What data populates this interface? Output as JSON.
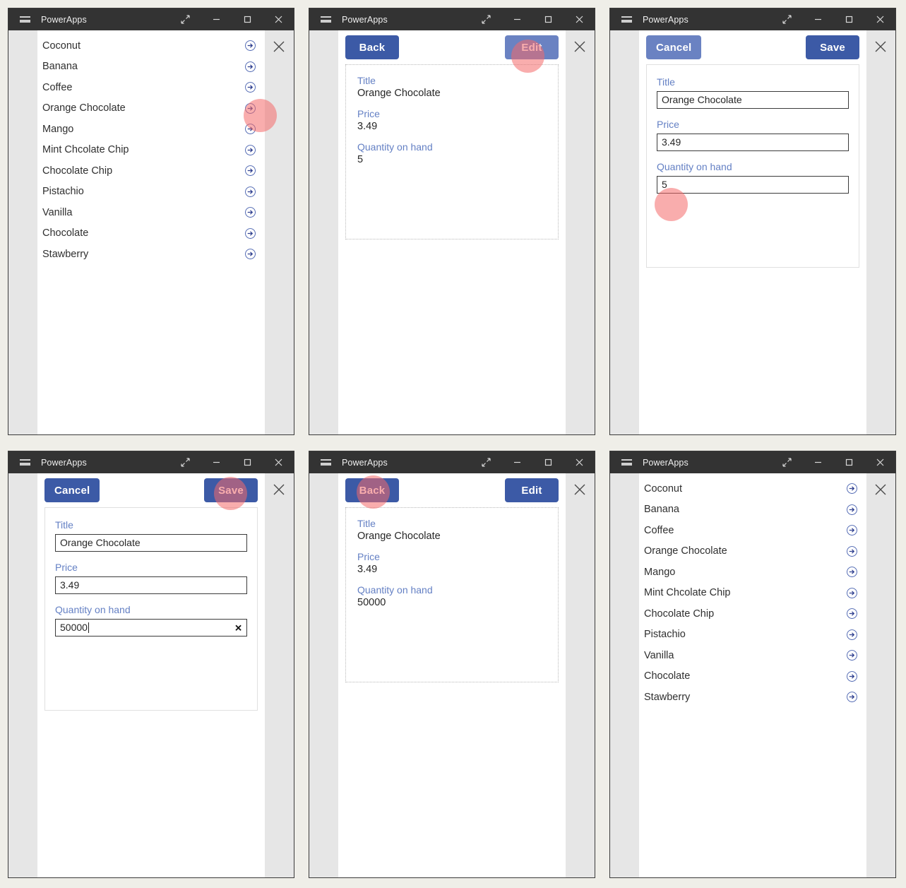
{
  "window": {
    "title": "PowerApps",
    "menu_icon": "hamburger-icon",
    "restore_icon": "expand-diagonal-icon",
    "minimize_icon": "minimize-icon",
    "maximize_icon": "maximize-icon",
    "close_icon": "close-icon",
    "app_close_icon": "close-icon"
  },
  "gallery": {
    "items": [
      "Coconut",
      "Banana",
      "Coffee",
      "Orange Chocolate",
      "Mango",
      "Mint Chcolate Chip",
      "Chocolate Chip",
      "Pistachio",
      "Vanilla",
      "Chocolate",
      "Stawberry"
    ],
    "row_icon": "arrow-right-circle-icon"
  },
  "detail": {
    "back_label": "Back",
    "edit_label": "Edit",
    "fields": [
      {
        "label": "Title",
        "value": "Orange Chocolate"
      },
      {
        "label": "Price",
        "value": "3.49"
      },
      {
        "label": "Quantity on hand",
        "value": "5"
      }
    ],
    "fields_after": [
      {
        "label": "Title",
        "value": "Orange Chocolate"
      },
      {
        "label": "Price",
        "value": "3.49"
      },
      {
        "label": "Quantity on hand",
        "value": "50000"
      }
    ]
  },
  "edit": {
    "cancel_label": "Cancel",
    "save_label": "Save",
    "clear_icon": "clear-x-icon",
    "fields_before": [
      {
        "label": "Title",
        "value": "Orange Chocolate"
      },
      {
        "label": "Price",
        "value": "3.49"
      },
      {
        "label": "Quantity on hand",
        "value": "5"
      }
    ],
    "fields_after": [
      {
        "label": "Title",
        "value": "Orange Chocolate"
      },
      {
        "label": "Price",
        "value": "3.49"
      },
      {
        "label": "Quantity on hand",
        "value": "50000"
      }
    ]
  },
  "colors": {
    "accent": "#3c5aa6",
    "accent_hover": "#6a82c2",
    "field_label": "#6480c4",
    "titlebar": "#333333",
    "click_marker": "#f46a6a"
  },
  "panels": [
    {
      "id": "p1",
      "name": "gallery-screen",
      "click_target": "arrow-right-circle-icon-orange-chocolate"
    },
    {
      "id": "p2",
      "name": "detail-screen",
      "click_target": "edit-button"
    },
    {
      "id": "p3",
      "name": "edit-screen",
      "click_target": "quantity-on-hand-input"
    },
    {
      "id": "p4",
      "name": "edit-screen-filled",
      "click_target": "save-button"
    },
    {
      "id": "p5",
      "name": "detail-screen-saved",
      "click_target": "back-button"
    },
    {
      "id": "p6",
      "name": "gallery-screen-final",
      "click_target": "none"
    }
  ]
}
